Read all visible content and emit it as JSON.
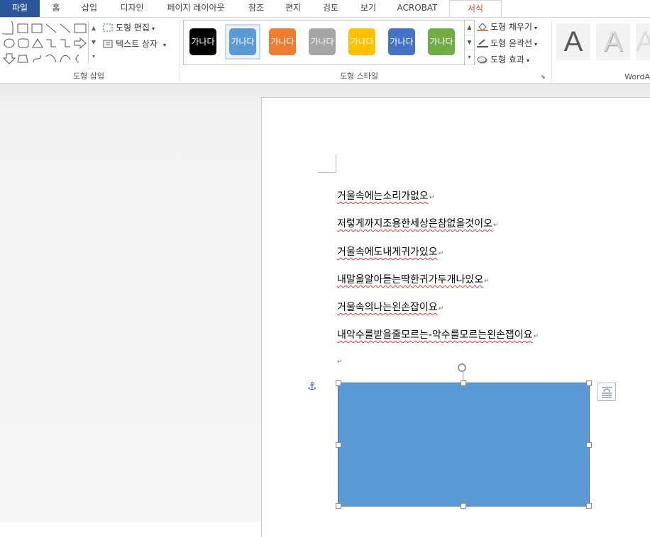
{
  "tabs": [
    "파일",
    "홈",
    "삽입",
    "디자인",
    "페이지 레이아웃",
    "참조",
    "편지",
    "검토",
    "보기",
    "ACROBAT",
    "서식"
  ],
  "active_tab": "서식",
  "ribbon": {
    "insert_shapes": {
      "label": "도형 삽입",
      "edit_shape": "도형 편집",
      "text_box": "텍스트 상자"
    },
    "shape_styles": {
      "label": "도형 스타일",
      "preset_text": "가나다",
      "preset_colors": [
        "#000000",
        "#5b9bd5",
        "#ed7d31",
        "#a5a5a5",
        "#ffc000",
        "#4472c4",
        "#70ad47"
      ],
      "selected_index": 1,
      "fill": "도형 채우기",
      "outline": "도형 윤곽선",
      "effects": "도형 효과"
    },
    "wordart": {
      "label": "WordA",
      "sample_letter": "A"
    }
  },
  "document": {
    "lines": [
      "거울속에는소리가없오",
      "저렇게까지조용한세상은참없을것이오",
      "거울속에도내게귀가있오",
      "내말을알아듣는딱한귀가두개나있오",
      "거울속의나는왼손잡이요",
      "내악수를받을줄모르는-악수를모르는왼손잽이요"
    ],
    "paragraph_mark": "↵",
    "shape_fill": "#5b9bd5"
  }
}
